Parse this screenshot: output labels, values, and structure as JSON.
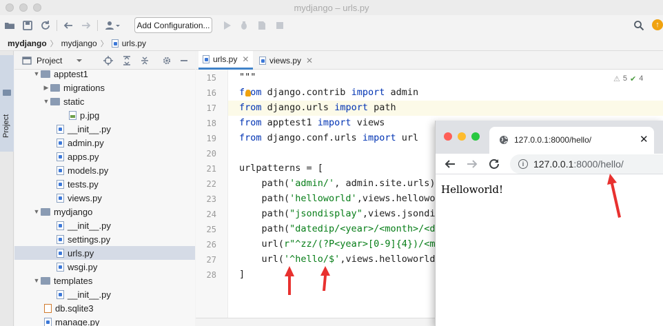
{
  "window": {
    "title": "mydjango – urls.py"
  },
  "toolbar": {
    "config_label": "Add Configuration...",
    "notification": "↑"
  },
  "breadcrumb": [
    "mydjango",
    "mydjango",
    "urls.py"
  ],
  "sidebar": {
    "tab_label": "Project"
  },
  "project": {
    "title": "Project",
    "tree": [
      {
        "label": "apptest1",
        "type": "folder",
        "expanded": true
      },
      {
        "label": "migrations",
        "type": "folder",
        "expanded": false
      },
      {
        "label": "static",
        "type": "folder",
        "expanded": true
      },
      {
        "label": "p.jpg",
        "type": "image"
      },
      {
        "label": "__init__.py",
        "type": "py"
      },
      {
        "label": "admin.py",
        "type": "py"
      },
      {
        "label": "apps.py",
        "type": "py"
      },
      {
        "label": "models.py",
        "type": "py"
      },
      {
        "label": "tests.py",
        "type": "py"
      },
      {
        "label": "views.py",
        "type": "py"
      },
      {
        "label": "mydjango",
        "type": "folder",
        "expanded": true
      },
      {
        "label": "__init__.py",
        "type": "py"
      },
      {
        "label": "settings.py",
        "type": "py"
      },
      {
        "label": "urls.py",
        "type": "py",
        "selected": true
      },
      {
        "label": "wsgi.py",
        "type": "py"
      },
      {
        "label": "templates",
        "type": "folder",
        "expanded": true
      },
      {
        "label": "__init__.py",
        "type": "py"
      },
      {
        "label": "db.sqlite3",
        "type": "db"
      },
      {
        "label": "manage.py",
        "type": "py"
      }
    ]
  },
  "editor": {
    "tabs": [
      {
        "label": "urls.py",
        "active": true
      },
      {
        "label": "views.py",
        "active": false
      }
    ],
    "inspections": {
      "warnings": "5",
      "checks": "4"
    },
    "lines": [
      {
        "no": "15",
        "text": "\"\"\""
      },
      {
        "no": "16",
        "kw1": "from",
        "a": " django.contrib ",
        "kw2": "import",
        "b": " admin"
      },
      {
        "no": "17",
        "kw1": "from",
        "a": " django.urls ",
        "kw2": "import",
        "b": " path"
      },
      {
        "no": "18",
        "kw1": "from",
        "a": " apptest1 ",
        "kw2": "import",
        "b": " views"
      },
      {
        "no": "19",
        "kw1": "from",
        "a": " django.conf.urls ",
        "kw2": "import",
        "b": " url"
      },
      {
        "no": "20",
        "text": ""
      },
      {
        "no": "21",
        "text": "urlpatterns = ["
      },
      {
        "no": "22",
        "pre": "    path(",
        "s": "'admin/'",
        "post": ", admin.site.urls),"
      },
      {
        "no": "23",
        "pre": "    path(",
        "s": "'helloworld'",
        "post": ",views.hellowor"
      },
      {
        "no": "24",
        "pre": "    path(",
        "s": "\"jsondisplay\"",
        "post": ",views.jsondip"
      },
      {
        "no": "25",
        "pre": "    path(",
        "s": "\"datedip/<year>/<month>/<da",
        "post": ""
      },
      {
        "no": "26",
        "pre": "    url(",
        "s": "r\"^zz/(?P<year>[0-9]{4})/<mo",
        "post": ""
      },
      {
        "no": "27",
        "pre": "    url(",
        "s": "'^hello/$'",
        "post": ",views.helloworld)"
      },
      {
        "no": "28",
        "text": "]"
      }
    ]
  },
  "browser": {
    "tab_title": "127.0.0.1:8000/hello/",
    "tab_close": "✕",
    "url_host": "127.0.0.1",
    "url_rest": ":8000/hello/",
    "content": "Helloworld!",
    "info_icon": "i"
  },
  "colors": {
    "keyword": "#0033b3",
    "string": "#067d17",
    "arrow": "#e8312f",
    "selection": "#d5dbe6"
  }
}
